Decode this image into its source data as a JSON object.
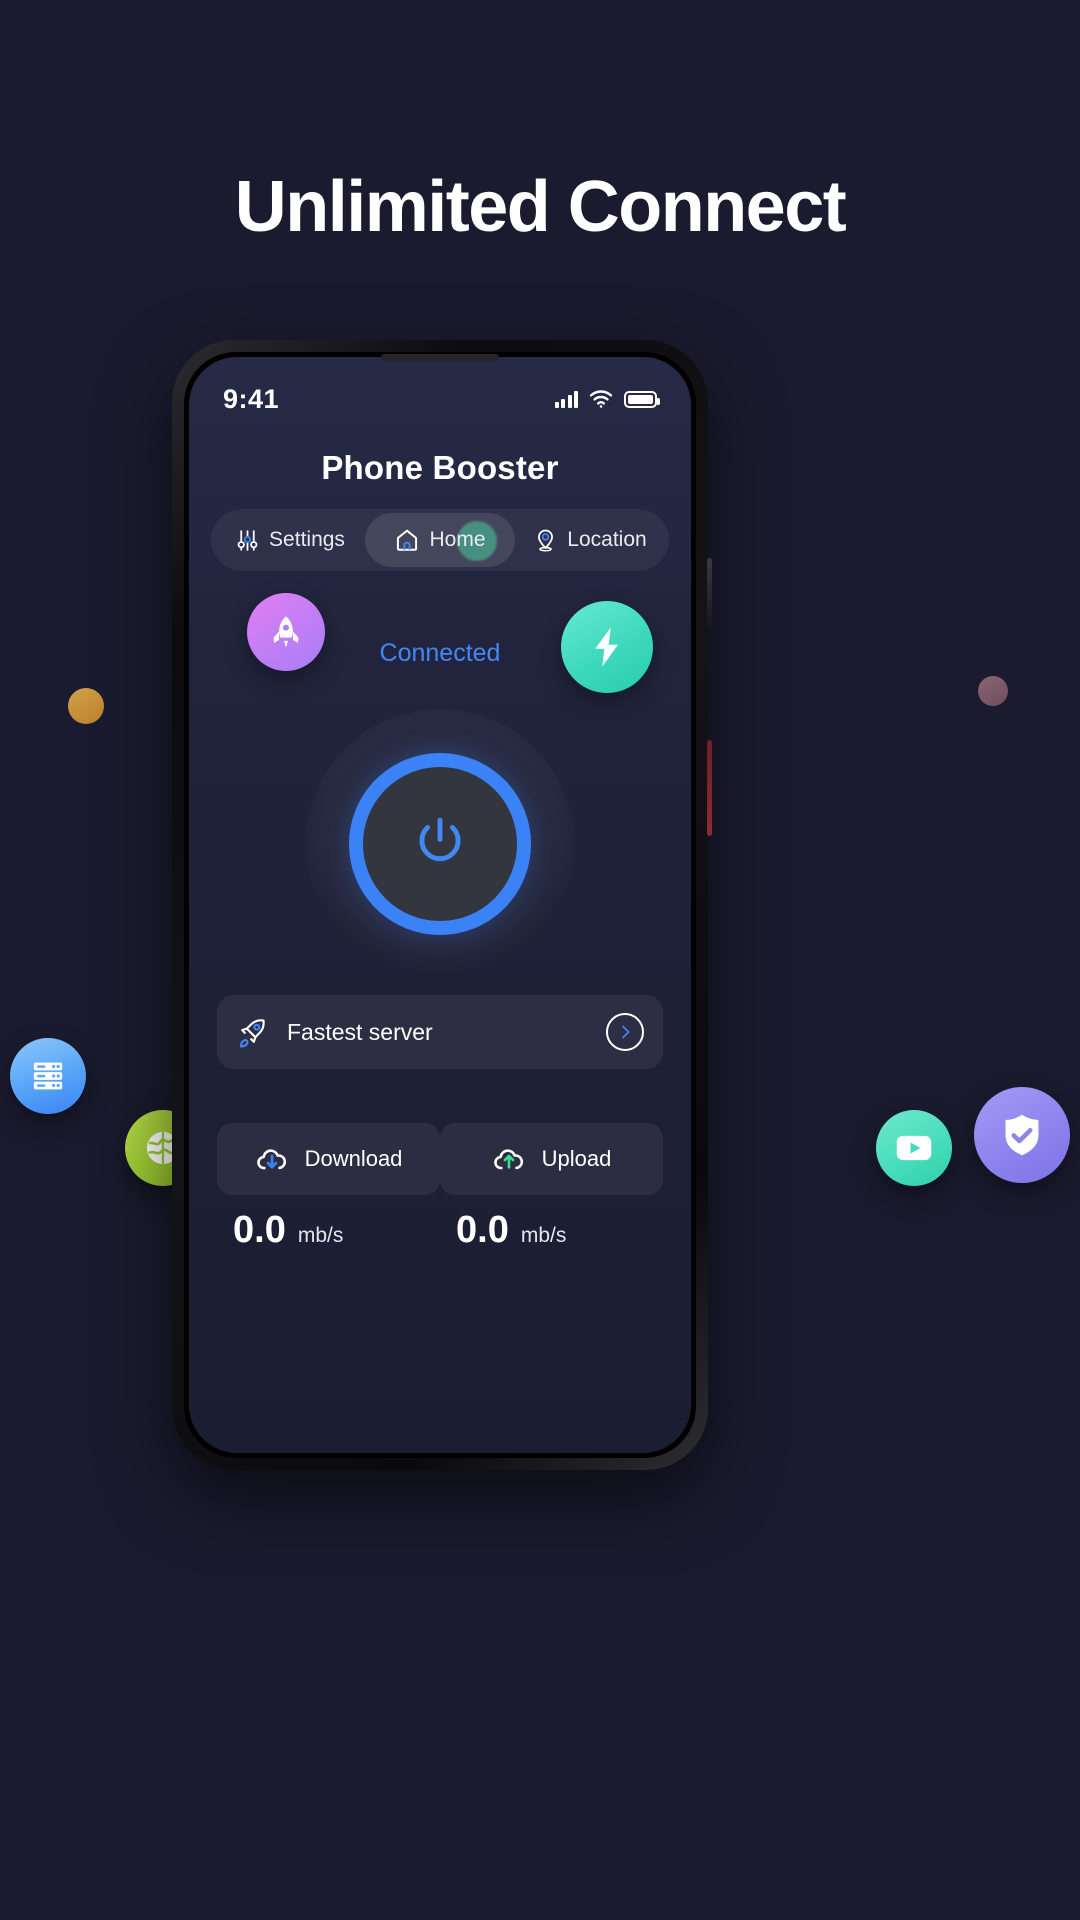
{
  "headline": "Unlimited Connect",
  "theme": {
    "background": "#1a1b2e",
    "accent_blue": "#3b82f6",
    "connected_text": "#4287f5",
    "screen_bg": "#21243c"
  },
  "phone": {
    "status_bar": {
      "time": "9:41",
      "icons": [
        "signal-bars-icon",
        "wifi-icon",
        "battery-icon"
      ]
    },
    "app_title": "Phone Booster",
    "tabs": [
      {
        "label": "Settings",
        "icon": "sliders-icon",
        "active": false
      },
      {
        "label": "Home",
        "icon": "home-icon",
        "active": true
      },
      {
        "label": "Location",
        "icon": "map-pin-icon",
        "active": false
      }
    ],
    "connection": {
      "status": "Connected",
      "left_badge_icon": "rocket-icon",
      "right_badge_icon": "lightning-bolt-icon",
      "power_button_icon": "power-icon"
    },
    "server_row": {
      "icon": "rocket-outline-icon",
      "label": "Fastest server",
      "chevron_icon": "chevron-right-icon"
    },
    "speed": {
      "cards": [
        {
          "label": "Download",
          "icon": "cloud-download-icon",
          "icon_color": "#3b82f6",
          "value": "0.0",
          "unit": "mb/s"
        },
        {
          "label": "Upload",
          "icon": "cloud-upload-icon",
          "icon_color": "#3ddc97",
          "value": "0.0",
          "unit": "mb/s"
        }
      ]
    }
  },
  "floating_badges": [
    {
      "name": "server-rack-badge",
      "icon": "server-rack-icon",
      "color": "#3b82f6"
    },
    {
      "name": "shield-check-badge",
      "icon": "shield-check-icon",
      "color": "#8d84ee"
    },
    {
      "name": "globe-badge",
      "icon": "globe-icon",
      "color": "#9ecb33"
    },
    {
      "name": "video-play-badge",
      "icon": "play-rectangle-icon",
      "color": "#45dcb9"
    },
    {
      "name": "mask-shield-badge",
      "icon": "mask-shield-icon",
      "color": "#fcbe46"
    }
  ],
  "decor_dots": [
    {
      "name": "amber-dot",
      "color": "#c07f2c"
    },
    {
      "name": "mauve-dot",
      "color": "#6f4f5d"
    },
    {
      "name": "steel-dot",
      "color": "#657c96"
    }
  ]
}
